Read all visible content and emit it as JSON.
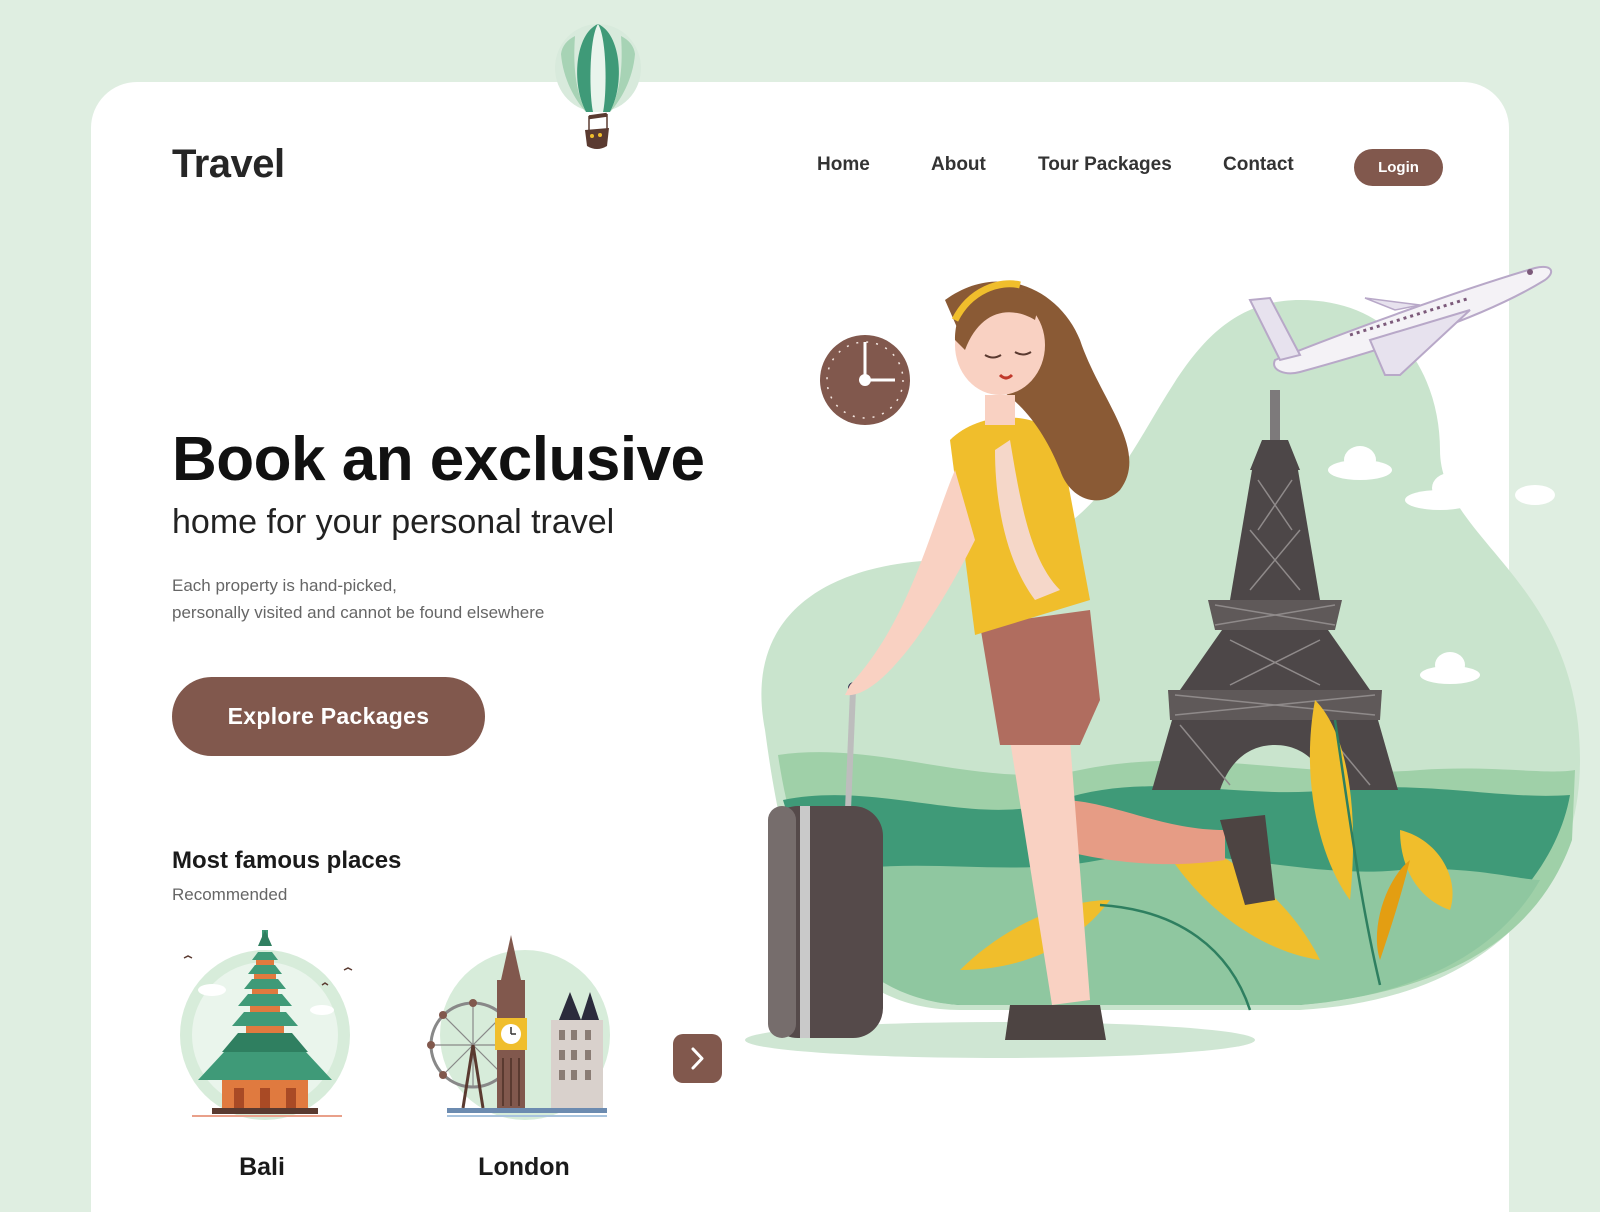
{
  "header": {
    "logo": "Travel",
    "nav": [
      "Home",
      "About",
      "Tour Packages",
      "Contact"
    ],
    "login_label": "Login"
  },
  "hero": {
    "title": "Book an exclusive",
    "subtitle": "home for your personal travel",
    "description_lines": [
      "Each property is hand-picked,",
      "personally visited and cannot be found elsewhere"
    ],
    "cta_label": "Explore Packages"
  },
  "places": {
    "title": "Most famous places",
    "subtitle": "Recommended",
    "items": [
      {
        "name": "Bali",
        "illustration": "bali-temple-illustration"
      },
      {
        "name": "London",
        "illustration": "london-landmarks-illustration"
      }
    ],
    "next_icon": "chevron-right-icon"
  },
  "colors": {
    "accent": "#81584d",
    "background": "#dfeee1",
    "blob_green": "#c9e4cd",
    "hill_dark": "#3f9a78",
    "shirt_yellow": "#f0be2c"
  },
  "decor": {
    "icons": [
      "hot-air-balloon-icon",
      "clock-icon",
      "airplane-icon",
      "eiffel-tower-icon",
      "suitcase-icon"
    ]
  }
}
